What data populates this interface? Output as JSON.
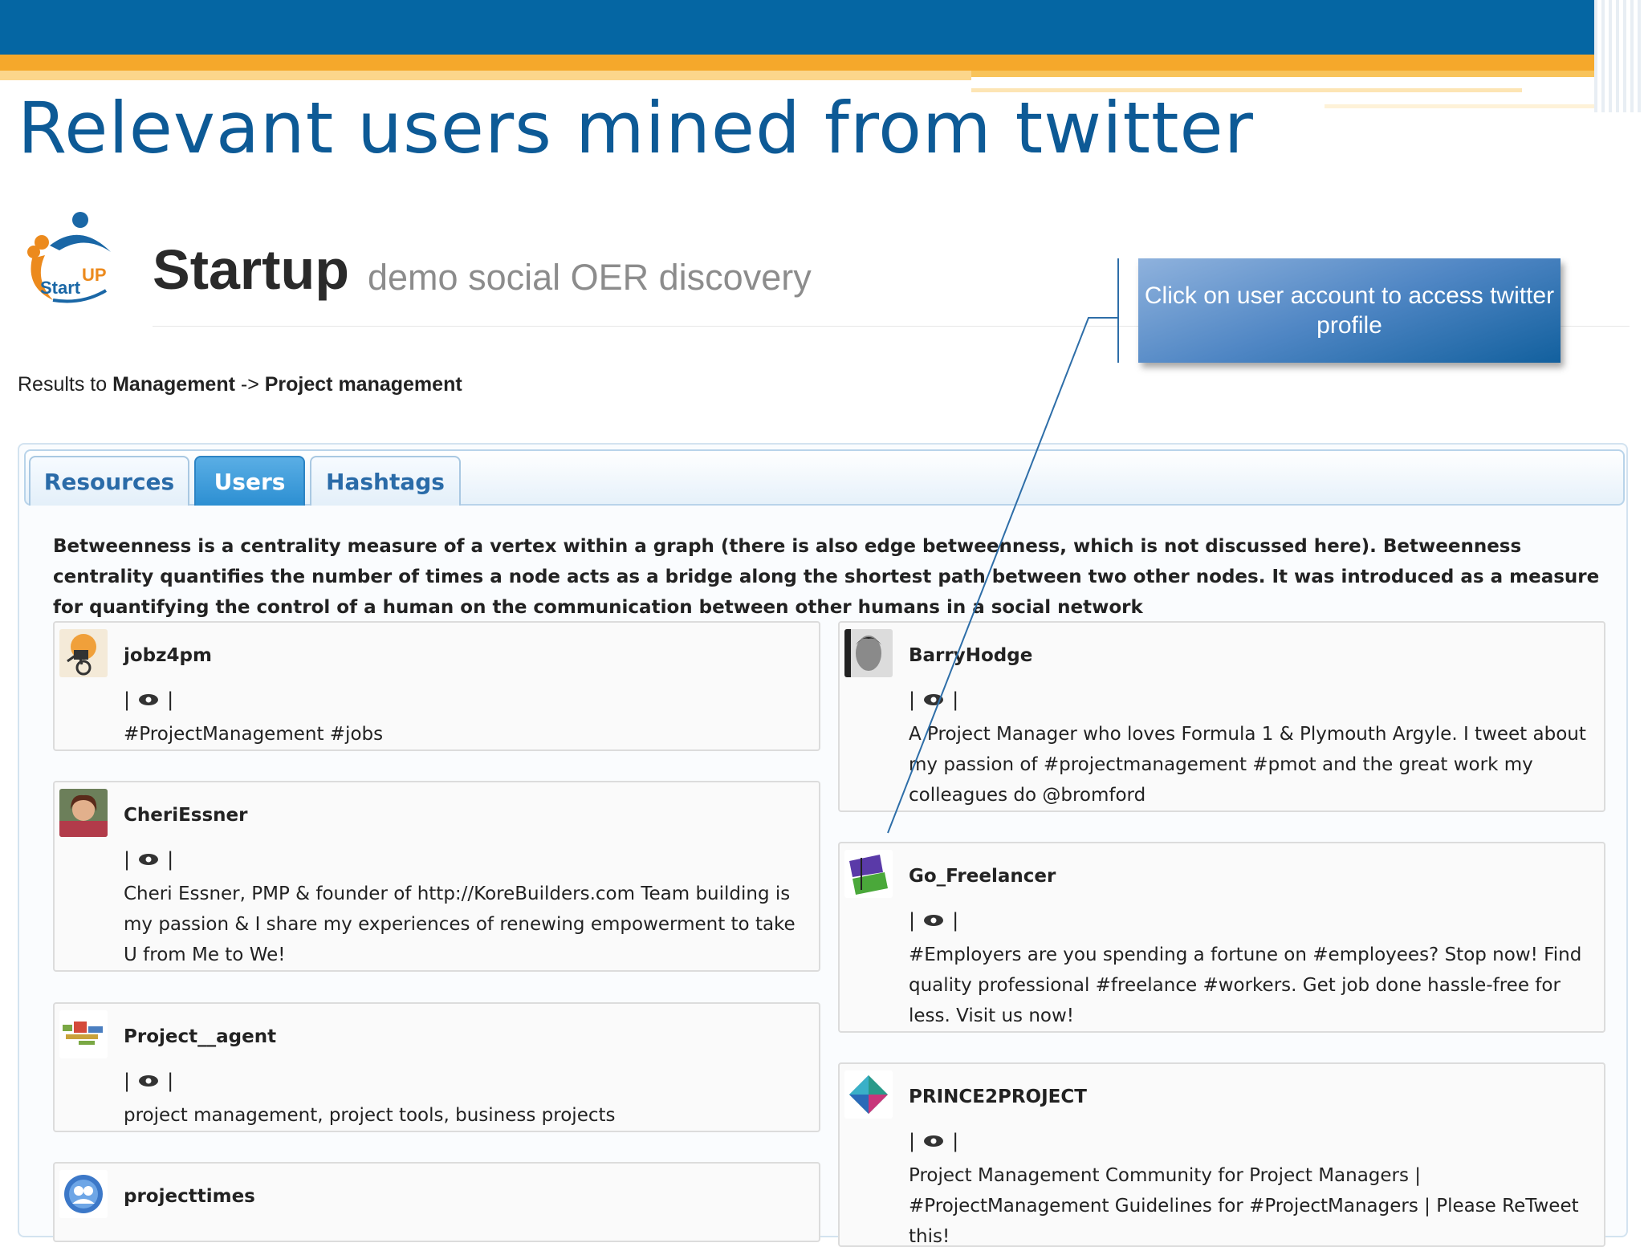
{
  "slide": {
    "title": "Relevant users mined from twitter"
  },
  "app": {
    "logo_start": "Start",
    "logo_up": "UP",
    "title": "Startup",
    "subtitle": "demo social OER discovery"
  },
  "breadcrumb": {
    "prefix": "Results to ",
    "category": "Management",
    "separator": " -> ",
    "topic": "Project management"
  },
  "tabs": [
    {
      "label": "Resources",
      "active": false
    },
    {
      "label": "Users",
      "active": true
    },
    {
      "label": "Hashtags",
      "active": false
    }
  ],
  "description": "Betweenness is a centrality measure of a vertex within a graph (there is also edge betweenness, which is not discussed here). Betweenness centrality quantifies the number of times a node acts as a bridge along the shortest path between two other nodes. It was introduced as a measure for quantifying the control of a human on the communication between other humans in a social network",
  "callout": {
    "text": "Click on user account to access twitter profile"
  },
  "users": [
    {
      "name": "jobz4pm",
      "bio": "#ProjectManagement #jobs",
      "column": "left"
    },
    {
      "name": "CheriEssner",
      "bio": "Cheri Essner, PMP & founder of http://KoreBuilders.com Team building is my passion & I share my experiences of renewing empowerment to take U from Me to We!",
      "column": "left"
    },
    {
      "name": "Project__agent",
      "bio": "project management, project tools, business projects",
      "column": "left"
    },
    {
      "name": "projecttimes",
      "bio": "",
      "column": "left"
    },
    {
      "name": "BarryHodge",
      "bio": "A Project Manager who loves Formula 1 & Plymouth Argyle. I tweet about my passion of #projectmanagement #pmot and the great work my colleagues do @bromford",
      "column": "right"
    },
    {
      "name": "Go_Freelancer",
      "bio": "#Employers are you spending a fortune on #employees? Stop now! Find quality professional #freelance #workers. Get job done hassle-free for less. Visit us now!",
      "column": "right"
    },
    {
      "name": "PRINCE2PROJECT",
      "bio": "Project Management Community for Project Managers | #ProjectManagement Guidelines for #ProjectManagers | Please ReTweet this!",
      "column": "right"
    }
  ],
  "action_separator": "|",
  "colors": {
    "header_blue": "#0566a3",
    "accent_orange": "#f5a82b",
    "title_blue": "#0d5a96",
    "active_tab": "#2c8fd2"
  }
}
